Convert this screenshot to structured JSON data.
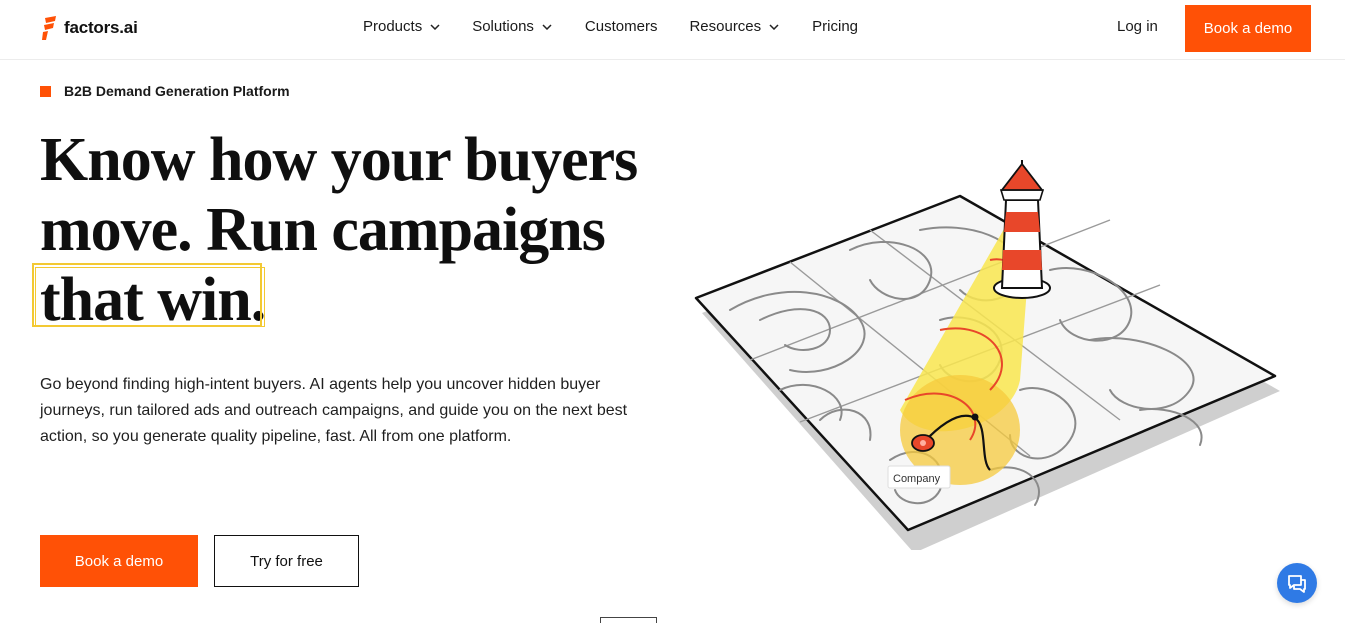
{
  "brand": {
    "name": "factors.ai",
    "accent": "#ff5106"
  },
  "nav": {
    "items": [
      {
        "label": "Products",
        "has_dropdown": true
      },
      {
        "label": "Solutions",
        "has_dropdown": true
      },
      {
        "label": "Customers",
        "has_dropdown": false
      },
      {
        "label": "Resources",
        "has_dropdown": true
      },
      {
        "label": "Pricing",
        "has_dropdown": false
      }
    ],
    "login_label": "Log in",
    "demo_label": "Book a demo"
  },
  "hero": {
    "eyebrow": "B2B Demand Generation Platform",
    "headline_line1": "Know how your buyers",
    "headline_line2": "move. Run campaigns",
    "headline_line3": "that win.",
    "description": "Go beyond finding high-intent buyers. AI agents help you uncover hidden buyer journeys, run tailored ads and outreach campaigns, and guide you on the next best action, so you generate quality pipeline, fast. All from one platform.",
    "cta_primary": "Book a demo",
    "cta_secondary": "Try for free"
  },
  "illustration": {
    "map_label": "Company",
    "highlight_color": "#f9e64f",
    "route_color": "#e8472a"
  },
  "chat": {
    "icon": "chat-bubbles-icon",
    "color": "#2f7ae5"
  }
}
